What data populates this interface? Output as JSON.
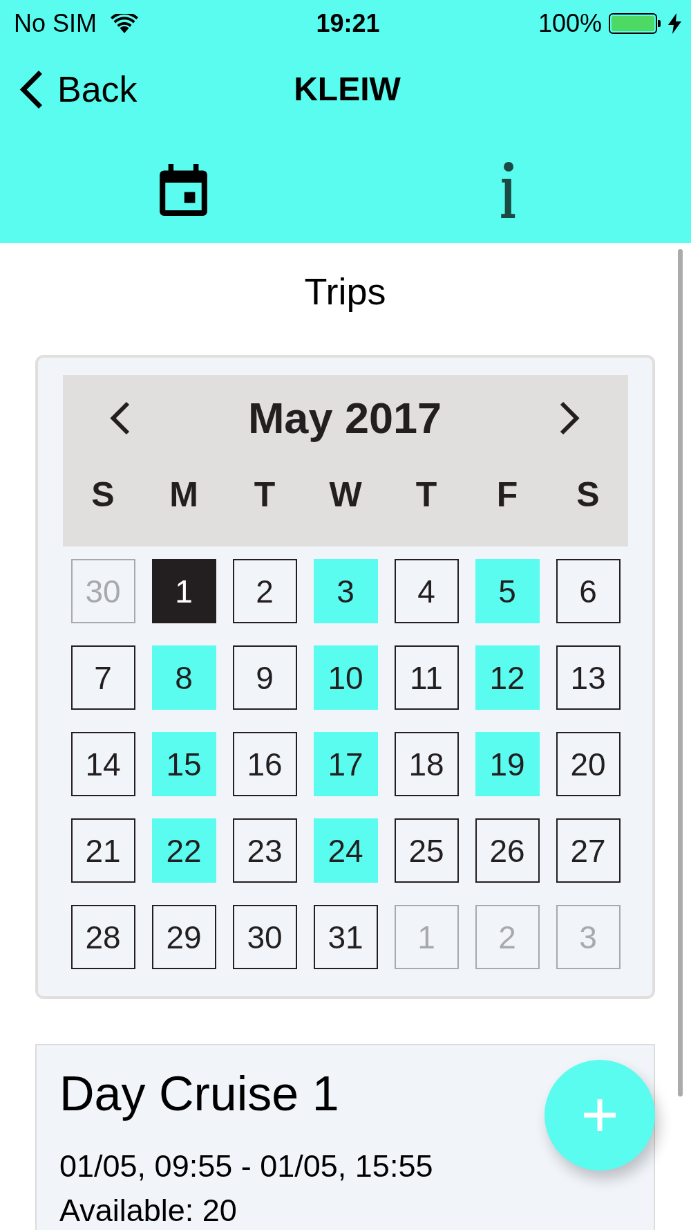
{
  "status_bar": {
    "carrier": "No SIM",
    "time": "19:21",
    "battery": "100%",
    "charging": true
  },
  "nav_bar": {
    "back": "Back",
    "title": "KLEIW"
  },
  "tabs": [
    {
      "kind": "calendar",
      "selected": true
    },
    {
      "kind": "info",
      "selected": false
    }
  ],
  "section_title": "Trips",
  "calendar": {
    "month": "May 2017",
    "weekdays": [
      "S",
      "M",
      "T",
      "W",
      "T",
      "F",
      "S"
    ],
    "days": [
      {
        "label": "30",
        "disabled": true,
        "selected": false,
        "marked": false
      },
      {
        "label": "1",
        "disabled": false,
        "selected": true,
        "marked": false
      },
      {
        "label": "2",
        "disabled": false,
        "selected": false,
        "marked": false
      },
      {
        "label": "3",
        "disabled": false,
        "selected": false,
        "marked": true
      },
      {
        "label": "4",
        "disabled": false,
        "selected": false,
        "marked": false
      },
      {
        "label": "5",
        "disabled": false,
        "selected": false,
        "marked": true
      },
      {
        "label": "6",
        "disabled": false,
        "selected": false,
        "marked": false
      },
      {
        "label": "7",
        "disabled": false,
        "selected": false,
        "marked": false
      },
      {
        "label": "8",
        "disabled": false,
        "selected": false,
        "marked": true
      },
      {
        "label": "9",
        "disabled": false,
        "selected": false,
        "marked": false
      },
      {
        "label": "10",
        "disabled": false,
        "selected": false,
        "marked": true
      },
      {
        "label": "11",
        "disabled": false,
        "selected": false,
        "marked": false
      },
      {
        "label": "12",
        "disabled": false,
        "selected": false,
        "marked": true
      },
      {
        "label": "13",
        "disabled": false,
        "selected": false,
        "marked": false
      },
      {
        "label": "14",
        "disabled": false,
        "selected": false,
        "marked": false
      },
      {
        "label": "15",
        "disabled": false,
        "selected": false,
        "marked": true
      },
      {
        "label": "16",
        "disabled": false,
        "selected": false,
        "marked": false
      },
      {
        "label": "17",
        "disabled": false,
        "selected": false,
        "marked": true
      },
      {
        "label": "18",
        "disabled": false,
        "selected": false,
        "marked": false
      },
      {
        "label": "19",
        "disabled": false,
        "selected": false,
        "marked": true
      },
      {
        "label": "20",
        "disabled": false,
        "selected": false,
        "marked": false
      },
      {
        "label": "21",
        "disabled": false,
        "selected": false,
        "marked": false
      },
      {
        "label": "22",
        "disabled": false,
        "selected": false,
        "marked": true
      },
      {
        "label": "23",
        "disabled": false,
        "selected": false,
        "marked": false
      },
      {
        "label": "24",
        "disabled": false,
        "selected": false,
        "marked": true
      },
      {
        "label": "25",
        "disabled": false,
        "selected": false,
        "marked": false
      },
      {
        "label": "26",
        "disabled": false,
        "selected": false,
        "marked": false
      },
      {
        "label": "27",
        "disabled": false,
        "selected": false,
        "marked": false
      },
      {
        "label": "28",
        "disabled": false,
        "selected": false,
        "marked": false
      },
      {
        "label": "29",
        "disabled": false,
        "selected": false,
        "marked": false
      },
      {
        "label": "30",
        "disabled": false,
        "selected": false,
        "marked": false
      },
      {
        "label": "31",
        "disabled": false,
        "selected": false,
        "marked": false
      },
      {
        "label": "1",
        "disabled": true,
        "selected": false,
        "marked": false
      },
      {
        "label": "2",
        "disabled": true,
        "selected": false,
        "marked": false
      },
      {
        "label": "3",
        "disabled": true,
        "selected": false,
        "marked": false
      }
    ]
  },
  "trips": [
    {
      "title": "Day Cruise 1",
      "time": "01/05, 09:55 - 01/05, 15:55",
      "availability": "Available: 20"
    }
  ]
}
